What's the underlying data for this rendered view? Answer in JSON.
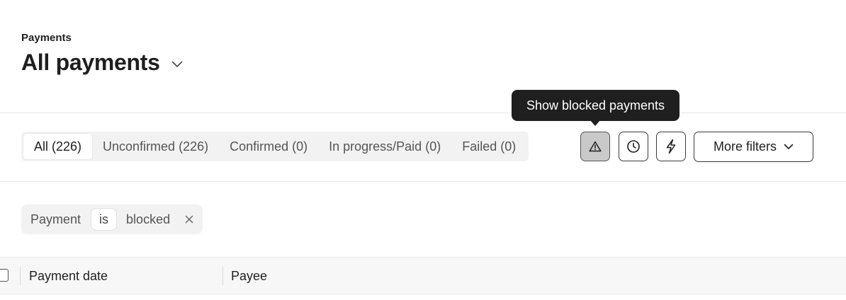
{
  "header": {
    "breadcrumb": "Payments",
    "title": "All payments"
  },
  "tabs": [
    {
      "label": "All (226)",
      "active": true
    },
    {
      "label": "Unconfirmed (226)",
      "active": false
    },
    {
      "label": "Confirmed (0)",
      "active": false
    },
    {
      "label": "In progress/Paid (0)",
      "active": false
    },
    {
      "label": "Failed (0)",
      "active": false
    }
  ],
  "toolbar": {
    "blocked_icon": "warning-triangle-icon",
    "scheduled_icon": "clock-icon",
    "instant_icon": "lightning-icon",
    "more_filters_label": "More filters",
    "tooltip": "Show blocked payments"
  },
  "filter_chip": {
    "field": "Payment",
    "operator": "is",
    "value": "blocked"
  },
  "table": {
    "columns": [
      "Payment date",
      "Payee"
    ]
  }
}
